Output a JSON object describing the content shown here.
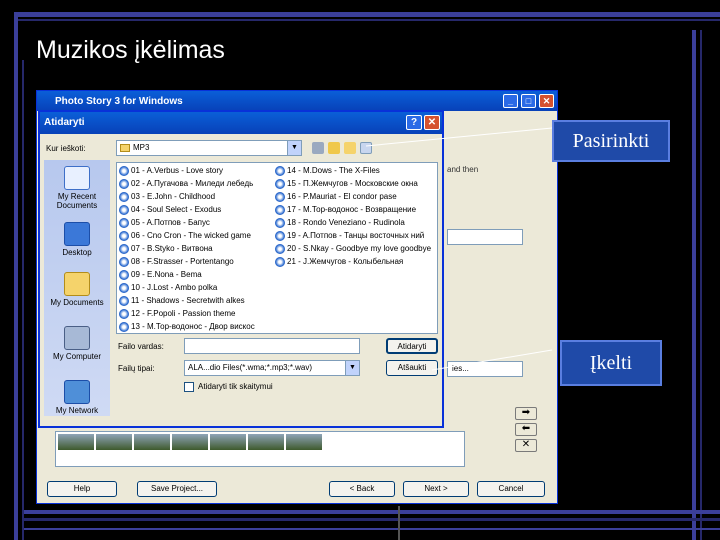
{
  "slide": {
    "title": "Muzikos įkėlimas"
  },
  "photo_story": {
    "title": "Photo Story 3 for Windows",
    "right_text": "and then",
    "field_text": "ies...",
    "buttons": {
      "help": "Help",
      "save_project": "Save Project...",
      "back": "< Back",
      "next": "Next >",
      "cancel": "Cancel"
    }
  },
  "open_dialog": {
    "title": "Atidaryti",
    "look_in_label": "Kur ieškoti:",
    "look_in_value": "MP3",
    "places": [
      "My Recent Documents",
      "Desktop",
      "My Documents",
      "My Computer",
      "My Network"
    ],
    "files_col1": [
      "01 - A.Verbus - Love story",
      "02 - A.Пугачова - Миледи лебедь",
      "03 - E.John - Childhood",
      "04 - Soul Select - Exodus",
      "05 - A.Потпов - Бапус",
      "06 - Cno Cron - The wicked game",
      "07 - B.Styko - Витвона",
      "08 - F.Strasser - Portentango",
      "09 - E.Nona - Bema",
      "10 - J.Lost - Ambo polka",
      "11 - Shadows - Secretwith alkes",
      "12 - F.Popoli - Passion theme",
      "13 - M.Тор-водонос - Двор вискос"
    ],
    "files_col2": [
      "14 - M.Dows - The X-Files",
      "15 - П.Жемчугов - Московские окна",
      "16 - P.Mauriat - El condor pase",
      "17 - М.Тор-водонос - Возвращение",
      "18 - Rondo Veneziano - Rudinola",
      "19 - A.Потпов - Танцы восточных ний",
      "20 - S.Nkay - Goodbye my love goodbye",
      "21 - J.Жемчугов - Колыбельная"
    ],
    "filename_label": "Failo vardas:",
    "filetype_label": "Failų tipai:",
    "filename_value": "",
    "filetype_value": "ALA...dio Files(*.wma;*.mp3;*.wav)",
    "open_button": "Atidaryti",
    "cancel_button": "Atšaukti",
    "readonly_label": "Atidaryti tik skaitymui"
  },
  "callouts": {
    "select": "Pasirinkti",
    "upload": "Įkelti"
  },
  "colors": {
    "slide_bg": "#000000",
    "accent_bar": "#3b3f9a",
    "titlebar": "#0a5fd8",
    "callout_bg": "#1f4aa8"
  }
}
